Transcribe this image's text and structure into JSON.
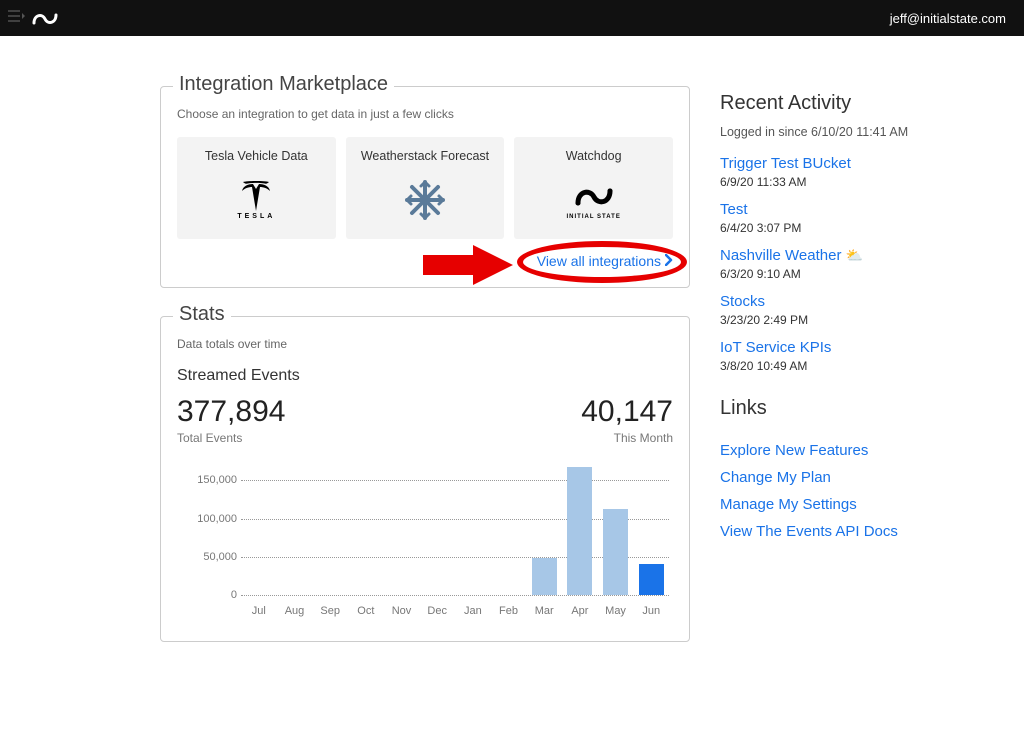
{
  "header": {
    "user_email": "jeff@initialstate.com"
  },
  "marketplace": {
    "title": "Integration Marketplace",
    "subtitle": "Choose an integration to get data in just a few clicks",
    "cards": [
      {
        "title": "Tesla Vehicle Data"
      },
      {
        "title": "Weatherstack Forecast"
      },
      {
        "title": "Watchdog"
      }
    ],
    "view_all": "View all integrations"
  },
  "stats": {
    "title": "Stats",
    "subtitle": "Data totals over time",
    "section": "Streamed Events",
    "total_value": "377,894",
    "total_label": "Total Events",
    "month_value": "40,147",
    "month_label": "This Month"
  },
  "chart_data": {
    "type": "bar",
    "categories": [
      "Jul",
      "Aug",
      "Sep",
      "Oct",
      "Nov",
      "Dec",
      "Jan",
      "Feb",
      "Mar",
      "Apr",
      "May",
      "Jun"
    ],
    "values": [
      0,
      0,
      0,
      0,
      0,
      0,
      0,
      0,
      48000,
      168000,
      112000,
      40000
    ],
    "current_index": 11,
    "ylabel": "",
    "xlabel": "",
    "ylim": [
      0,
      170000
    ],
    "yticks": [
      0,
      50000,
      100000,
      150000
    ],
    "ytick_labels": [
      "0",
      "50,000",
      "100,000",
      "150,000"
    ]
  },
  "recent": {
    "title": "Recent Activity",
    "logged_in": "Logged in since 6/10/20 11:41 AM",
    "items": [
      {
        "label": "Trigger Test BUcket",
        "time": "6/9/20 11:33 AM",
        "icon": ""
      },
      {
        "label": "Test",
        "time": "6/4/20 3:07 PM",
        "icon": ""
      },
      {
        "label": "Nashville Weather",
        "time": "6/3/20 9:10 AM",
        "icon": "⛅"
      },
      {
        "label": "Stocks",
        "time": "3/23/20 2:49 PM",
        "icon": ""
      },
      {
        "label": "IoT Service KPIs",
        "time": "3/8/20 10:49 AM",
        "icon": ""
      }
    ]
  },
  "links": {
    "title": "Links",
    "items": [
      "Explore New Features",
      "Change My Plan",
      "Manage My Settings",
      "View The Events API Docs"
    ]
  }
}
